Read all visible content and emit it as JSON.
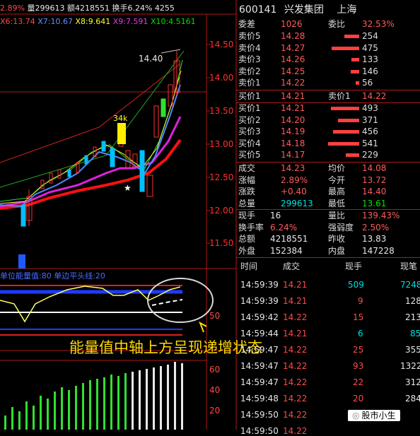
{
  "top_bar": {
    "change_pct": "2.89%",
    "volume": "量299613",
    "amount": "额4218551",
    "turnover": "换手6.24%",
    "extra": "4255"
  },
  "ma_bar": {
    "x6": "X6:13.74",
    "x7": "X7:10.67",
    "x8": "X8:9.641",
    "x9": "X9:7.591",
    "x10": "X10:4.5161"
  },
  "price_axis": [
    "14.50",
    "14.00",
    "13.50",
    "13.00",
    "12.50",
    "12.00",
    "11.50"
  ],
  "annotations": {
    "peak": "14.40",
    "vol_mark": "34k"
  },
  "indicator": {
    "title": "单位能量值:80 单边平头线:20",
    "axis_50": "50"
  },
  "macd_axis": [
    "60",
    "40",
    "20"
  ],
  "caption": "能量值中轴上方呈现递增状态",
  "watermark": "股市小生",
  "stock": {
    "code": "600141",
    "name": "兴发集团",
    "market": "上海"
  },
  "order_book": {
    "weicha_label": "委差",
    "weicha": "1026",
    "weibi_label": "委比",
    "weibi": "32.53%",
    "sells": [
      {
        "label": "卖价5",
        "price": "14.28",
        "vol": "254"
      },
      {
        "label": "卖价4",
        "price": "14.27",
        "vol": "475"
      },
      {
        "label": "卖价3",
        "price": "14.26",
        "vol": "133"
      },
      {
        "label": "卖价2",
        "price": "14.25",
        "vol": "146"
      },
      {
        "label": "卖价1",
        "price": "14.22",
        "vol": "56"
      }
    ],
    "buy1_label": "买价1",
    "buy1": "14.21",
    "sell1_label": "卖价1",
    "sell1": "14.22",
    "buys": [
      {
        "label": "买价1",
        "price": "14.21",
        "vol": "493"
      },
      {
        "label": "买价2",
        "price": "14.20",
        "vol": "371"
      },
      {
        "label": "买价3",
        "price": "14.19",
        "vol": "456"
      },
      {
        "label": "买价4",
        "price": "14.18",
        "vol": "541"
      },
      {
        "label": "买价5",
        "price": "14.17",
        "vol": "229"
      }
    ]
  },
  "stats": [
    {
      "l1": "成交",
      "v1": "14.23",
      "l2": "均价",
      "v2": "14.08"
    },
    {
      "l1": "涨幅",
      "v1": "2.89%",
      "l2": "今开",
      "v2": "13.72"
    },
    {
      "l1": "涨跌",
      "v1": "+0.40",
      "l2": "最高",
      "v2": "14.40"
    },
    {
      "l1": "总量",
      "v1": "299613",
      "l2": "最低",
      "v2": "13.61"
    }
  ],
  "stats2": [
    {
      "l1": "现手",
      "v1": "16",
      "l2": "量比",
      "v2": "139.43%"
    },
    {
      "l1": "换手率",
      "v1": "6.24%",
      "l2": "强弱度",
      "v2": "2.50%"
    },
    {
      "l1": "总额",
      "v1": "4218551",
      "l2": "昨收",
      "v2": "13.83"
    },
    {
      "l1": "外盘",
      "v1": "152384",
      "l2": "内盘",
      "v2": "147228"
    }
  ],
  "ticks_header": {
    "time": "时间",
    "deal": "成交",
    "hand": "现手",
    "count": "现笔"
  },
  "ticks": [
    {
      "time": "14:59:39",
      "price": "14.21",
      "hand": "509",
      "count": "7248"
    },
    {
      "time": "14:59:39",
      "price": "14.21",
      "hand": "9",
      "count": "128"
    },
    {
      "time": "14:59:42",
      "price": "14.22",
      "hand": "15",
      "count": "213"
    },
    {
      "time": "14:59:44",
      "price": "14.21",
      "hand": "6",
      "count": "85"
    },
    {
      "time": "14:59:47",
      "price": "14.22",
      "hand": "25",
      "count": "355"
    },
    {
      "time": "14:59:47",
      "price": "14.22",
      "hand": "93",
      "count": "1322"
    },
    {
      "time": "14:59:47",
      "price": "14.22",
      "hand": "22",
      "count": "312"
    },
    {
      "time": "14:59:48",
      "price": "14.22",
      "hand": "20",
      "count": "284"
    },
    {
      "time": "14:59:50",
      "price": "14.22",
      "hand": "",
      "count": ""
    },
    {
      "time": "14:59:50",
      "price": "14.22",
      "hand": "",
      "count": ""
    }
  ]
}
